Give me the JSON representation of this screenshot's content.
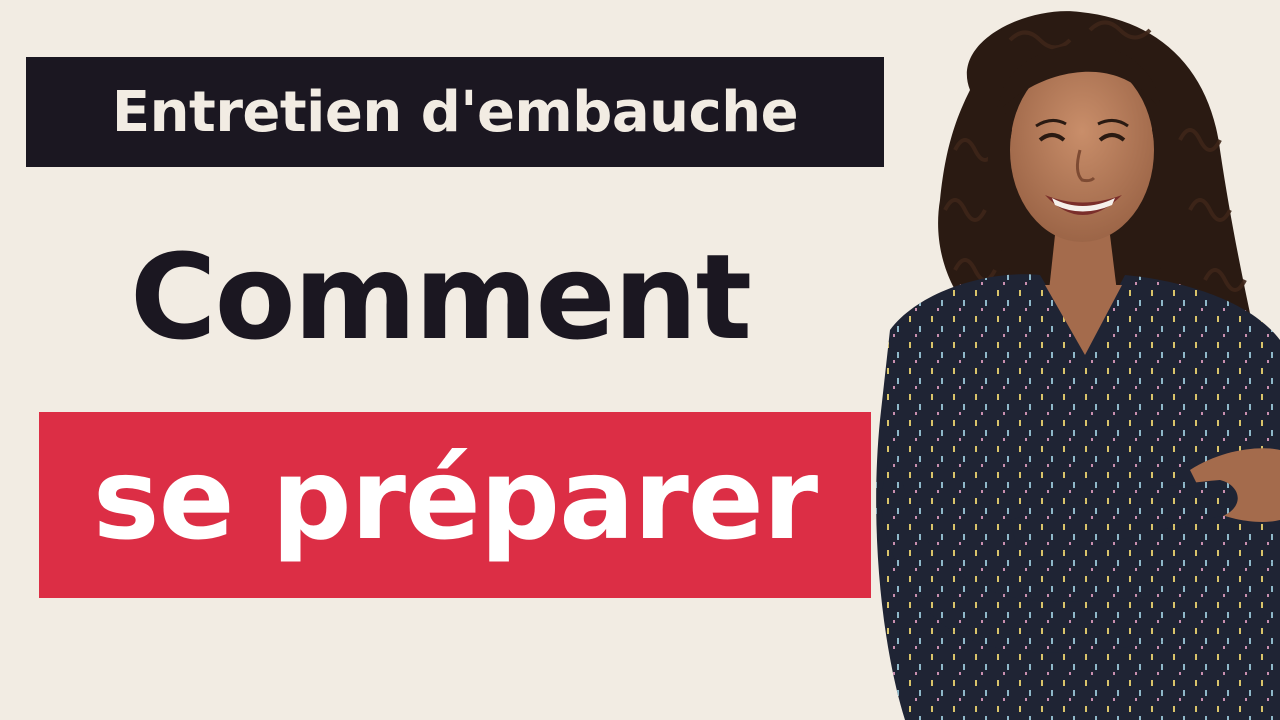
{
  "thumbnail": {
    "label_top": "Entretien d'embauche",
    "headline": "Comment",
    "subheadline": "se préparer"
  },
  "colors": {
    "background": "#F2ECE3",
    "label_top_bg": "#1B1721",
    "label_top_text": "#F2ECE3",
    "headline_text": "#1B1721",
    "subheadline_bg": "#DC2E45",
    "subheadline_text": "#FFFFFF"
  },
  "photo": {
    "subject": "smiling-woman-arms-crossed"
  }
}
